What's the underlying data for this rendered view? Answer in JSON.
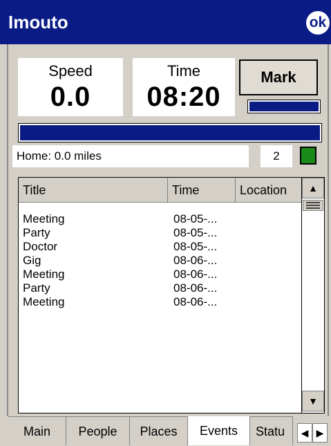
{
  "titlebar": {
    "title": "Imouto",
    "ok_label": "ok"
  },
  "speed": {
    "label": "Speed",
    "value": "0.0"
  },
  "time": {
    "label": "Time",
    "value": "08:20"
  },
  "mark_button": {
    "label": "Mark"
  },
  "home": {
    "text": "Home: 0.0 miles",
    "count": "2"
  },
  "events": {
    "columns": [
      "Title",
      "Time",
      "Location"
    ],
    "rows": [
      {
        "title": "Meeting",
        "time": "08-05-..."
      },
      {
        "title": "Party",
        "time": "08-05-..."
      },
      {
        "title": "Doctor",
        "time": "08-05-..."
      },
      {
        "title": "Gig",
        "time": "08-06-..."
      },
      {
        "title": "Meeting",
        "time": "08-06-..."
      },
      {
        "title": "Party",
        "time": "08-06-..."
      },
      {
        "title": "Meeting",
        "time": "08-06-..."
      }
    ]
  },
  "tabs": [
    "Main",
    "People",
    "Places",
    "Events",
    "Statu"
  ],
  "active_tab": "Events",
  "colors": {
    "title_bar": "#0a1b86",
    "accent_bar": "#0a1b86",
    "status_light": "#1a8a18"
  },
  "icons": {
    "ok": "ok-circle-icon",
    "scroll_up": "up-arrow-icon",
    "scroll_down": "down-arrow-icon",
    "tab_left": "left-arrow-icon",
    "tab_right": "right-arrow-icon"
  }
}
